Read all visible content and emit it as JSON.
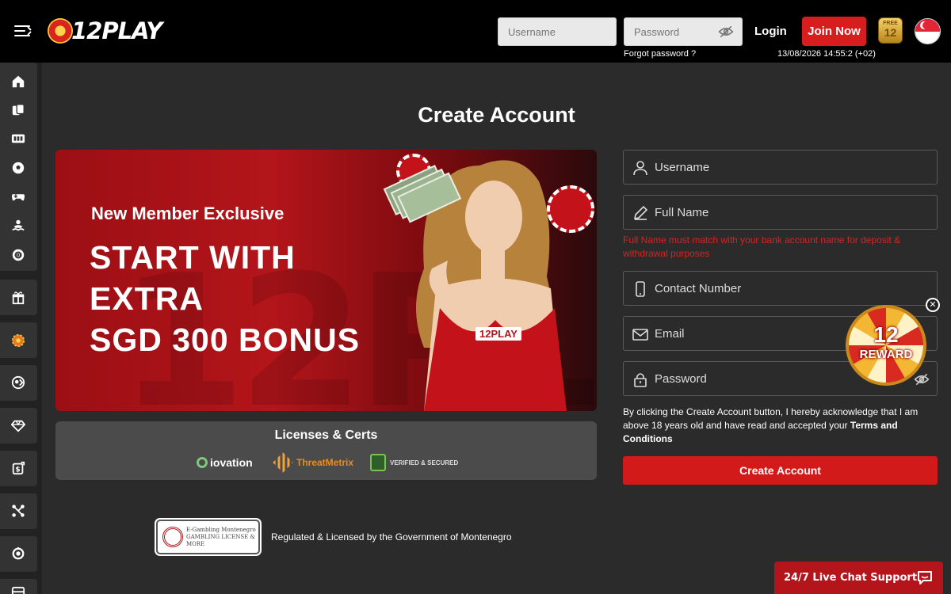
{
  "header": {
    "logo_text": "12PLAY",
    "username_placeholder": "Username",
    "password_placeholder": "Password",
    "forgot_password": "Forgot password ?",
    "login_label": "Login",
    "join_label": "Join Now",
    "datetime": "13/08/2026 14:55:2 (+02)",
    "free12_badge": {
      "top": "FREE",
      "num": "12"
    },
    "country_flag": "singapore-flag"
  },
  "sidebar": {
    "items": [
      {
        "icon": "home-icon"
      },
      {
        "icon": "cards-icon"
      },
      {
        "icon": "slots-icon"
      },
      {
        "icon": "soccer-icon"
      },
      {
        "icon": "gamepad-icon"
      },
      {
        "icon": "fishing-icon"
      },
      {
        "icon": "lottery-icon"
      },
      {
        "icon": "gift-icon"
      },
      {
        "icon": "wheel-icon"
      },
      {
        "icon": "referral-icon"
      },
      {
        "icon": "vip-diamond-icon"
      },
      {
        "icon": "rebate-icon"
      },
      {
        "icon": "affiliate-icon"
      },
      {
        "icon": "coin-icon"
      },
      {
        "icon": "more-icon"
      }
    ]
  },
  "page": {
    "title": "Create Account"
  },
  "banner": {
    "subtitle": "New Member Exclusive",
    "headline": [
      "START WITH",
      "EXTRA",
      "SGD 300 BONUS"
    ],
    "brand_tag": "12PLAY"
  },
  "licenses": {
    "title": "Licenses & Certs",
    "logos": [
      "iovation",
      "ThreatMetrix",
      "VERIFIED & SECURED"
    ],
    "badge_text": [
      "E-Gambling Montenegro",
      "GAMBLING LICENSE & MORE"
    ],
    "regulated_text": "Regulated & Licensed by the Government of Montenegro"
  },
  "form": {
    "username_placeholder": "Username",
    "fullname_placeholder": "Full Name",
    "fullname_warning": "Full Name must match with your bank account name for deposit & withdrawal purposes",
    "contact_placeholder": "Contact Number",
    "email_placeholder": "Email",
    "password_placeholder": "Password",
    "terms_prefix": "By clicking the Create Account button, I hereby acknowledge that I am above 18 years old and have read and accepted your ",
    "terms_link": "Terms and Conditions",
    "submit_label": "Create Account"
  },
  "reward_widget": {
    "number": "12",
    "label": "REWARD"
  },
  "chat": {
    "label": "24/7 Live Chat Support"
  },
  "colors": {
    "accent_red": "#d21a1a",
    "warning_red": "#d7241f",
    "header_bg": "#000000",
    "page_bg": "#2b2b2b"
  }
}
